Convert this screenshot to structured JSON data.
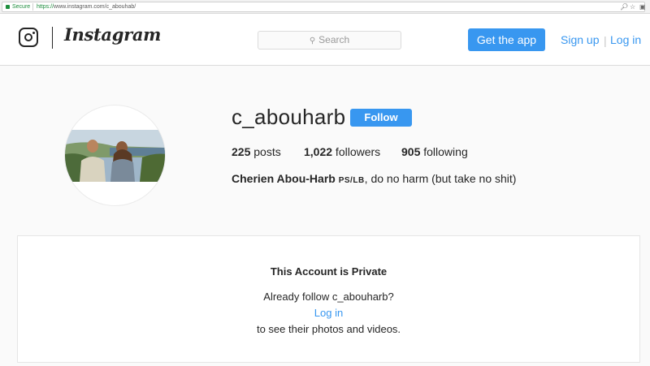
{
  "browser": {
    "secure_label": "Secure",
    "url_scheme": "https://",
    "url_rest": "www.instagram.com/c_abouhab/"
  },
  "header": {
    "logo_text": "Instagram",
    "search_placeholder": "Search",
    "get_app_label": "Get the app",
    "signup_label": "Sign up",
    "separator": "|",
    "login_label": "Log in"
  },
  "profile": {
    "username": "c_abouharb",
    "follow_label": "Follow",
    "posts_count": "225",
    "posts_label": " posts",
    "followers_count": "1,022",
    "followers_label": " followers",
    "following_count": "905",
    "following_label": " following",
    "bio_name": "Cherien Abou-Harb",
    "bio_flag": "PS/LB",
    "bio_text": ", do no harm (but take no shit)"
  },
  "private": {
    "title": "This Account is Private",
    "already_follow": "Already follow c_abouharb?",
    "login_link": "Log in",
    "see_photos": "to see their photos and videos."
  },
  "colors": {
    "accent": "#3897f0",
    "background": "#fafafa",
    "text": "#262626"
  },
  "icons": [
    "lock-icon",
    "instagram-glyph-icon",
    "search-icon",
    "zoom-icon",
    "star-icon",
    "camera-icon"
  ]
}
